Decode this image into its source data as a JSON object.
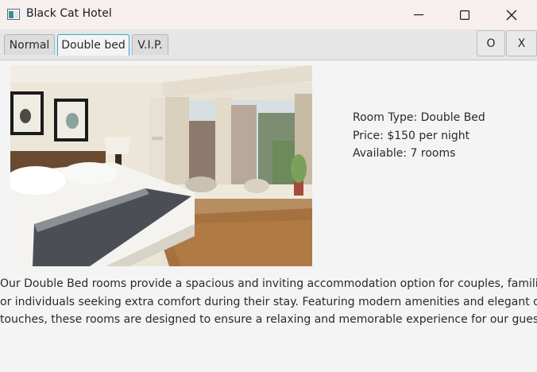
{
  "window": {
    "title": "Black Cat Hotel"
  },
  "tabs": [
    {
      "label": "Normal",
      "selected": false
    },
    {
      "label": "Double bed",
      "selected": true
    },
    {
      "label": "V.I.P.",
      "selected": false
    }
  ],
  "tab_buttons": {
    "o_label": "O",
    "x_label": "X"
  },
  "room": {
    "type_line": "Room Type: Double Bed",
    "price_line": "Price: $150 per night",
    "available_line": "Available: 7 rooms",
    "description_lines": [
      "Our Double Bed rooms provide a spacious and inviting accommodation option for couples, families,",
      "or individuals seeking extra comfort during their stay. Featuring modern amenities and elegant design",
      "touches, these rooms are designed to ensure a relaxing and memorable experience for our guests."
    ]
  },
  "colors": {
    "title_bar": "#f6efee",
    "tab_bar": "#e6e6e6",
    "selected_tab_border": "#39a6df",
    "background": "#f4f4f4"
  }
}
